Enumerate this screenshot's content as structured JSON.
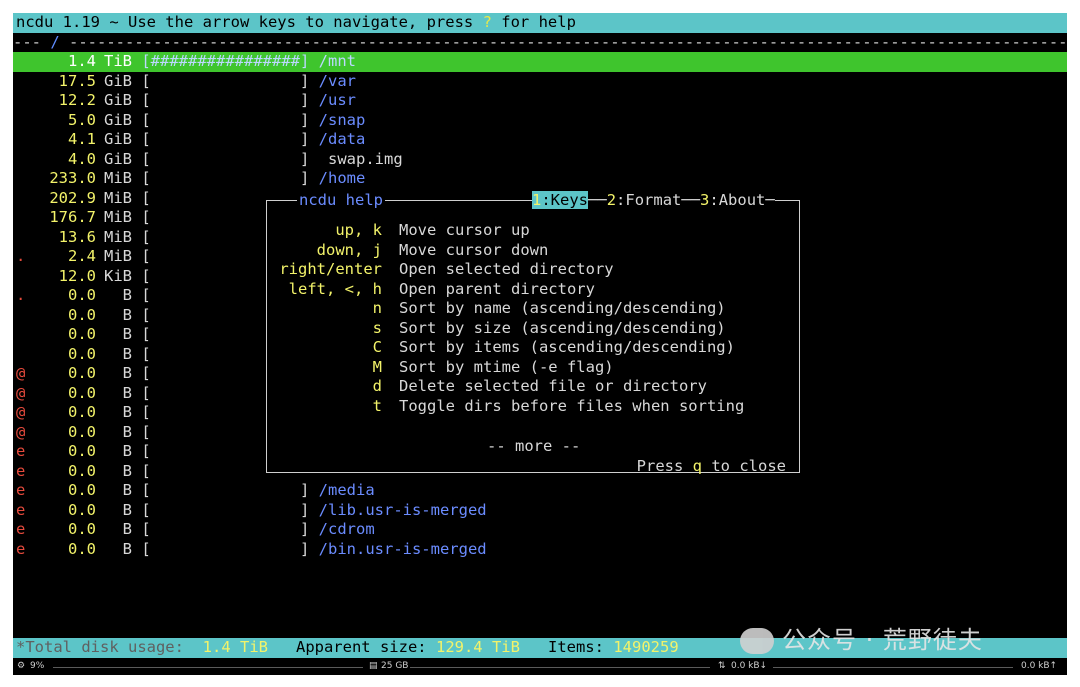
{
  "header": {
    "prefix": "ncdu 1.19 ~ Use the arrow keys to navigate, press ",
    "key": "?",
    "suffix": " for help"
  },
  "path": {
    "lead": "--- ",
    "current": "/",
    "trail": " ----------------------------------------------------------------------------------------------------------------"
  },
  "rows": [
    {
      "flag": "",
      "size": "1.4",
      "unit": "TiB",
      "graph": "[################]",
      "name": " /mnt",
      "is_dir": true
    },
    {
      "flag": "",
      "size": "17.5",
      "unit": "GiB",
      "graph": "[                ]",
      "name": " /var",
      "is_dir": true
    },
    {
      "flag": "",
      "size": "12.2",
      "unit": "GiB",
      "graph": "[                ]",
      "name": " /usr",
      "is_dir": true
    },
    {
      "flag": "",
      "size": "5.0",
      "unit": "GiB",
      "graph": "[                ]",
      "name": " /snap",
      "is_dir": true
    },
    {
      "flag": "",
      "size": "4.1",
      "unit": "GiB",
      "graph": "[                ]",
      "name": " /data",
      "is_dir": true
    },
    {
      "flag": "",
      "size": "4.0",
      "unit": "GiB",
      "graph": "[                ]",
      "name": "  swap.img",
      "is_dir": false
    },
    {
      "flag": "",
      "size": "233.0",
      "unit": "MiB",
      "graph": "[                ]",
      "name": " /home",
      "is_dir": true
    },
    {
      "flag": "",
      "size": "202.9",
      "unit": "MiB",
      "graph": "[",
      "name": "",
      "is_dir": true
    },
    {
      "flag": "",
      "size": "176.7",
      "unit": "MiB",
      "graph": "[",
      "name": "",
      "is_dir": true
    },
    {
      "flag": "",
      "size": "13.6",
      "unit": "MiB",
      "graph": "[",
      "name": "",
      "is_dir": true
    },
    {
      "flag": ".",
      "size": "2.4",
      "unit": "MiB",
      "graph": "[",
      "name": "",
      "is_dir": true
    },
    {
      "flag": "",
      "size": "12.0",
      "unit": "KiB",
      "graph": "[",
      "name": "",
      "is_dir": true
    },
    {
      "flag": ".",
      "size": "0.0",
      "unit": "B",
      "graph": "[",
      "name": "",
      "is_dir": true
    },
    {
      "flag": "",
      "size": "0.0",
      "unit": "B",
      "graph": "[",
      "name": "",
      "is_dir": true
    },
    {
      "flag": "",
      "size": "0.0",
      "unit": "B",
      "graph": "[",
      "name": "",
      "is_dir": true
    },
    {
      "flag": "",
      "size": "0.0",
      "unit": "B",
      "graph": "[",
      "name": "",
      "is_dir": true
    },
    {
      "flag": "@",
      "size": "0.0",
      "unit": "B",
      "graph": "[",
      "name": "",
      "is_dir": true
    },
    {
      "flag": "@",
      "size": "0.0",
      "unit": "B",
      "graph": "[",
      "name": "",
      "is_dir": true
    },
    {
      "flag": "@",
      "size": "0.0",
      "unit": "B",
      "graph": "[",
      "name": "",
      "is_dir": true
    },
    {
      "flag": "@",
      "size": "0.0",
      "unit": "B",
      "graph": "[",
      "name": "",
      "is_dir": true
    },
    {
      "flag": "e",
      "size": "0.0",
      "unit": "B",
      "graph": "[",
      "name": "",
      "is_dir": true
    },
    {
      "flag": "e",
      "size": "0.0",
      "unit": "B",
      "graph": "[",
      "name": "",
      "is_dir": true
    },
    {
      "flag": "e",
      "size": "0.0",
      "unit": "B",
      "graph": "[                ]",
      "name": " /media",
      "is_dir": true
    },
    {
      "flag": "e",
      "size": "0.0",
      "unit": "B",
      "graph": "[                ]",
      "name": " /lib.usr-is-merged",
      "is_dir": true
    },
    {
      "flag": "e",
      "size": "0.0",
      "unit": "B",
      "graph": "[                ]",
      "name": " /cdrom",
      "is_dir": true
    },
    {
      "flag": "e",
      "size": "0.0",
      "unit": "B",
      "graph": "[                ]",
      "name": " /bin.usr-is-merged",
      "is_dir": true
    }
  ],
  "help": {
    "title": "ncdu help",
    "tabs": [
      {
        "num": "1",
        "label": ":Keys",
        "active": true
      },
      {
        "num": "2",
        "label": ":Format",
        "active": false
      },
      {
        "num": "3",
        "label": ":About",
        "active": false
      }
    ],
    "keys": [
      {
        "key": "up, k",
        "desc": "Move cursor up"
      },
      {
        "key": "down, j",
        "desc": "Move cursor down"
      },
      {
        "key": "right/enter",
        "desc": "Open selected directory"
      },
      {
        "key": "left, <, h",
        "desc": "Open parent directory"
      },
      {
        "key": "n",
        "desc": "Sort by name (ascending/descending)"
      },
      {
        "key": "s",
        "desc": "Sort by size (ascending/descending)"
      },
      {
        "key": "C",
        "desc": "Sort by items (ascending/descending)"
      },
      {
        "key": "M",
        "desc": "Sort by mtime (-e flag)"
      },
      {
        "key": "d",
        "desc": "Delete selected file or directory"
      },
      {
        "key": "t",
        "desc": "Toggle dirs before files when sorting"
      }
    ],
    "more": "-- more --",
    "close_prefix": "Press ",
    "close_key": "q",
    "close_suffix": " to close"
  },
  "footer": {
    "total_label": "*Total disk usage:",
    "total_value": "1.4 TiB",
    "apparent_label": "Apparent size:",
    "apparent_value": "129.4 TiB",
    "items_label": "Items:",
    "items_value": "1490259"
  },
  "statusbar": {
    "cpu": "9%",
    "mem": "25 GB",
    "down": "0.0 kB↓",
    "up": "0.0 kB↑"
  },
  "watermark": "公众号 · 荒野徒夫",
  "colors": {
    "accent": "#5cc5c8",
    "selected": "#3fc52d",
    "dir": "#6b8cff",
    "size": "#f3f36a"
  }
}
